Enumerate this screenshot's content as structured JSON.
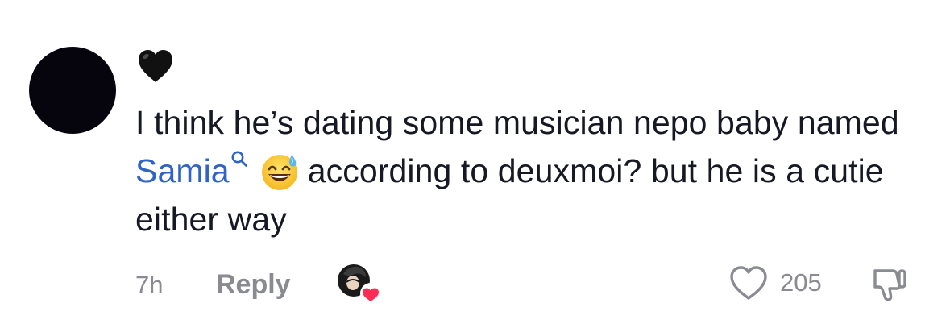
{
  "comment": {
    "username_emoji": "🖤",
    "text_before_mention": "I think he’s dating some musician nepo baby named ",
    "mention": "Samia",
    "emoji": "😅",
    "text_after_emoji": "according to deuxmoi? but he is a cutie either way",
    "timestamp": "7h",
    "reply_label": "Reply",
    "like_count": "205",
    "creator_liked": true
  },
  "icons": {
    "username": "black-heart-icon",
    "mention_search": "search-icon",
    "emoji": "grinning-sweat-emoji",
    "creator_like": "creator-avatar-heart-icon",
    "like": "heart-outline-icon",
    "dislike": "thumbs-down-icon"
  },
  "colors": {
    "text": "#161823",
    "mention": "#2f63c4",
    "secondary": "#8a8b91",
    "creator_heart": "#fe2c55",
    "avatar": "#06040c"
  }
}
